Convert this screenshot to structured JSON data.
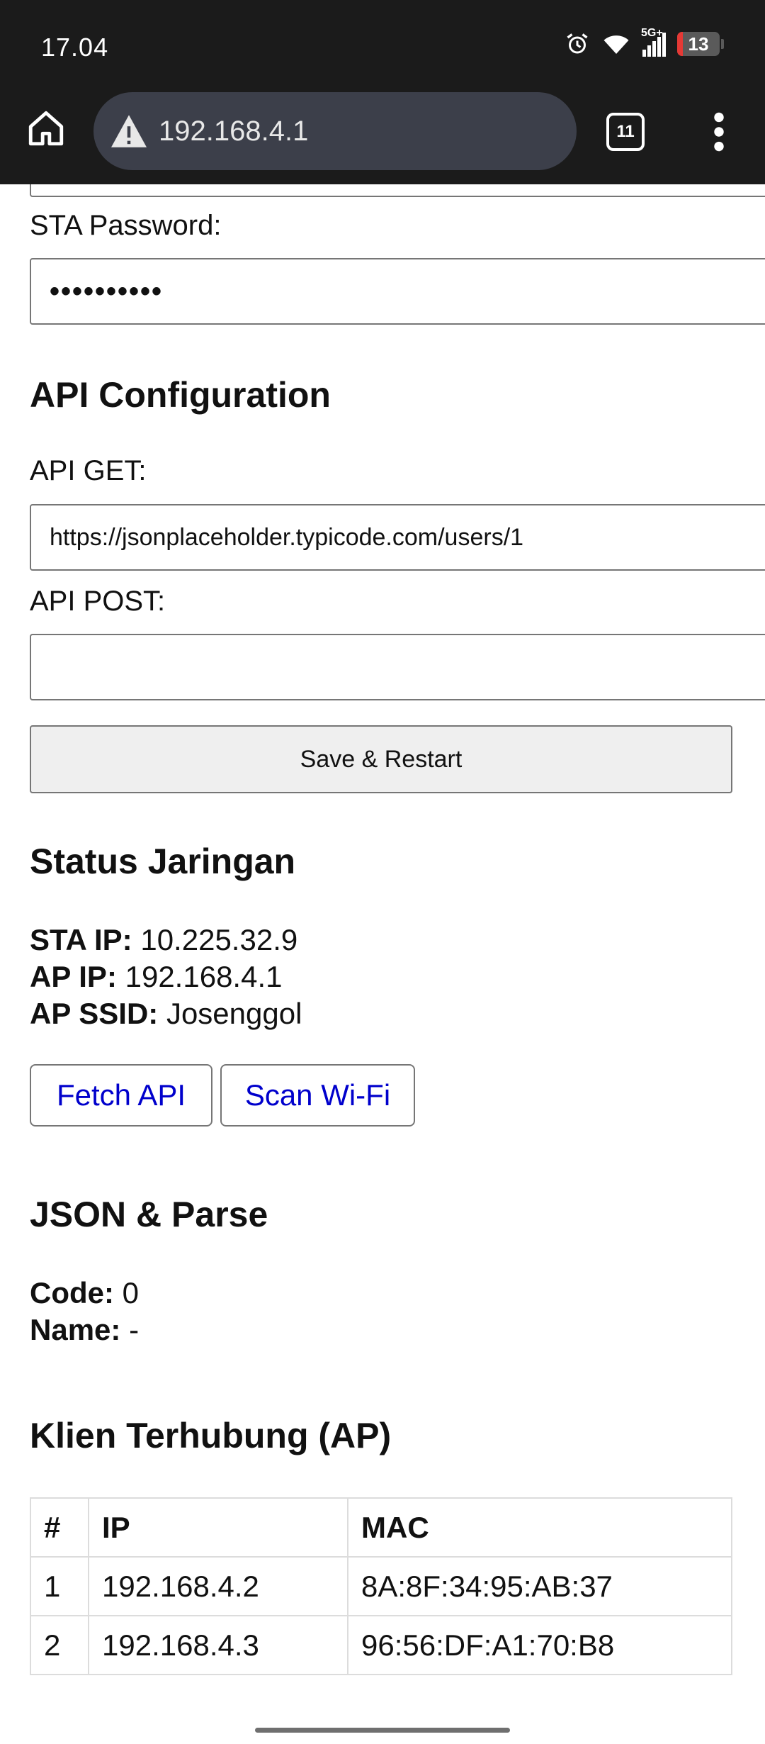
{
  "status_bar": {
    "time": "17.04",
    "icons": [
      "alarm-icon",
      "wifi-icon",
      "5g-signal-icon"
    ],
    "network_label": "5G+",
    "battery": "13",
    "battery_level": 0.13
  },
  "browser": {
    "url": "192.168.4.1",
    "tab_count": "11",
    "security": "not-secure-warning-icon"
  },
  "form": {
    "sta_password_label": "STA Password:",
    "sta_password_value": "••••••••••",
    "api_heading": "API Configuration",
    "api_get_label": "API GET:",
    "api_get_value": "https://jsonplaceholder.typicode.com/users/1",
    "api_post_label": "API POST:",
    "api_post_value": "",
    "save_button": "Save & Restart"
  },
  "network_status": {
    "heading": "Status Jaringan",
    "sta_ip_label": "STA IP:",
    "sta_ip": "10.225.32.9",
    "ap_ip_label": "AP IP:",
    "ap_ip": "192.168.4.1",
    "ap_ssid_label": "AP SSID:",
    "ap_ssid": "Josenggol",
    "fetch_button": "Fetch API",
    "scan_button": "Scan Wi-Fi"
  },
  "json_parse": {
    "heading": "JSON & Parse",
    "code_label": "Code:",
    "code": "0",
    "name_label": "Name:",
    "name": "-"
  },
  "clients": {
    "heading": "Klien Terhubung (AP)",
    "columns": [
      "#",
      "IP",
      "MAC"
    ],
    "rows": [
      [
        "1",
        "192.168.4.2",
        "8A:8F:34:95:AB:37"
      ],
      [
        "2",
        "192.168.4.3",
        "96:56:DF:A1:70:B8"
      ]
    ]
  },
  "colors": {
    "system_bar": "#1b1b1b",
    "omnibox": "#3c3f4a",
    "link": "#0000cc",
    "battery_low": "#e53935"
  }
}
